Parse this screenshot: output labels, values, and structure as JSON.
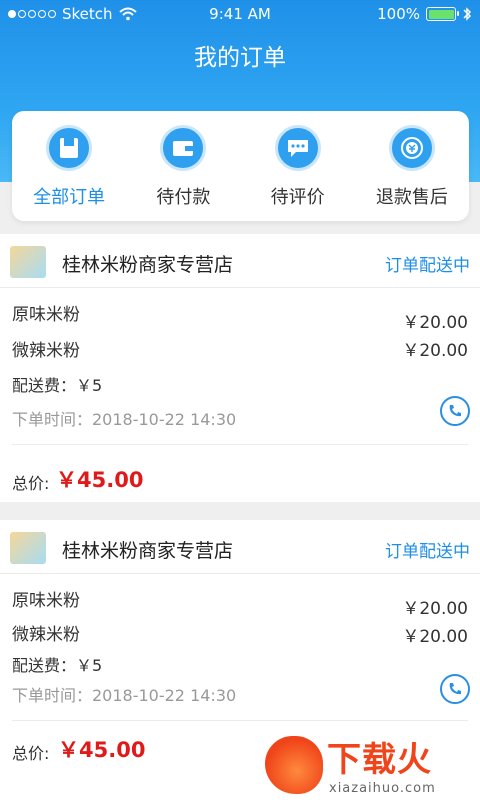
{
  "status_bar": {
    "carrier": "Sketch",
    "time": "9:41 AM",
    "battery": "100%"
  },
  "page_title": "我的订单",
  "tabs": [
    {
      "label": "全部订单",
      "icon": "order-icon",
      "active": true
    },
    {
      "label": "待付款",
      "icon": "wallet-icon",
      "active": false
    },
    {
      "label": "待评价",
      "icon": "chat-icon",
      "active": false
    },
    {
      "label": "退款售后",
      "icon": "refund-icon",
      "active": false
    }
  ],
  "orders": [
    {
      "shop": "桂林米粉商家专营店",
      "status": "订单配送中",
      "items": [
        {
          "name": "原味米粉",
          "price": "￥20.00"
        },
        {
          "name": "微辣米粉",
          "price": "￥20.00"
        }
      ],
      "delivery_fee": "配送费：￥5",
      "order_time": "下单时间：2018-10-22  14:30",
      "total_label": "总价:",
      "total": "￥45.00"
    },
    {
      "shop": "桂林米粉商家专营店",
      "status": "订单配送中",
      "items": [
        {
          "name": "原味米粉",
          "price": "￥20.00"
        },
        {
          "name": "微辣米粉",
          "price": "￥20.00"
        }
      ],
      "delivery_fee": "配送费：￥5",
      "order_time": "下单时间：2018-10-22  14:30",
      "total_label": "总价:",
      "total": "￥45.00"
    }
  ],
  "watermark": {
    "brand": "下载火",
    "site": "xiazaihuo.com"
  },
  "colors": {
    "accent": "#1e8fe6",
    "price_red": "#e01a1a",
    "header_blue": "#2fa6f2"
  }
}
